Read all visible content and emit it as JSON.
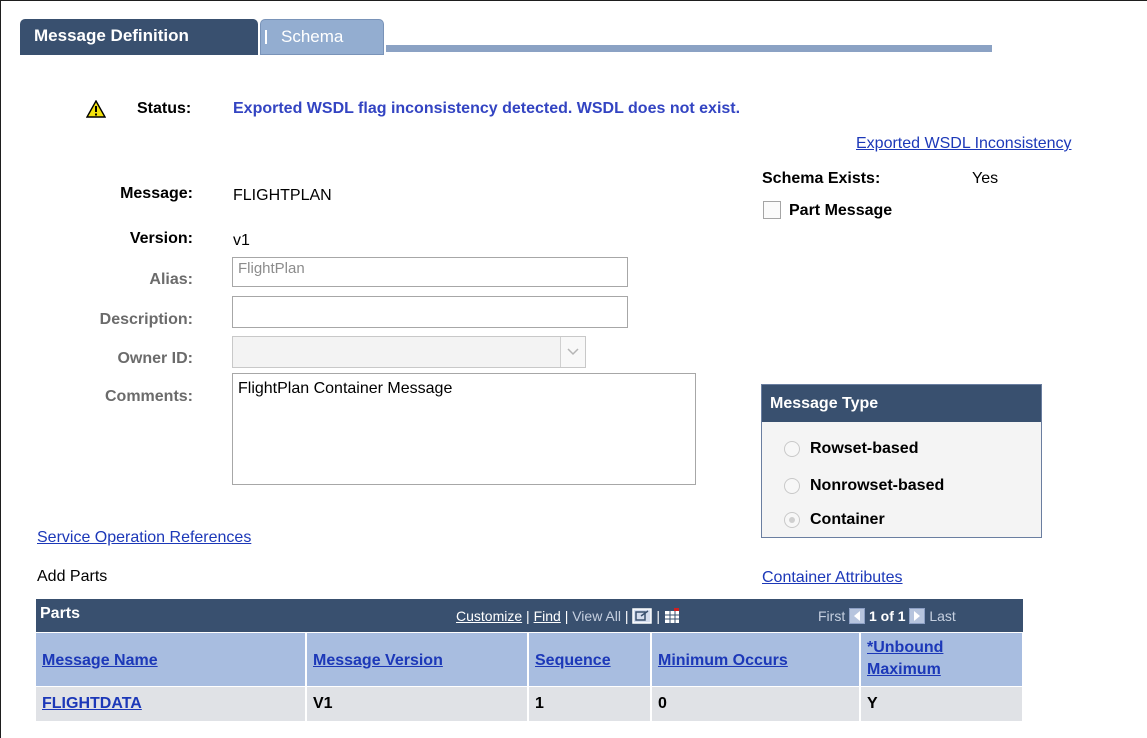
{
  "tabs": [
    {
      "label": "Message Definition",
      "active": true
    },
    {
      "label": "Schema",
      "active": false
    }
  ],
  "status": {
    "label": "Status:",
    "text": "Exported WSDL flag inconsistency detected.  WSDL does not exist.",
    "link": "Exported WSDL Inconsistency"
  },
  "schema": {
    "label": "Schema Exists:",
    "value": "Yes",
    "part_message_label": "Part Message",
    "part_message_checked": false
  },
  "fields": {
    "message_label": "Message:",
    "message_value": "FLIGHTPLAN",
    "version_label": "Version:",
    "version_value": "v1",
    "alias_label": "Alias:",
    "alias_value": "FlightPlan",
    "description_label": "Description:",
    "description_value": "",
    "owner_label": "Owner ID:",
    "owner_value": "",
    "comments_label": "Comments:",
    "comments_value": "FlightPlan Container Message"
  },
  "message_type": {
    "title": "Message Type",
    "options": [
      {
        "label": "Rowset-based",
        "selected": false
      },
      {
        "label": "Nonrowset-based",
        "selected": false
      },
      {
        "label": "Container",
        "selected": true
      }
    ]
  },
  "links": {
    "service_operation_references": "Service Operation References",
    "container_attributes": "Container Attributes"
  },
  "add_parts_label": "Add Parts",
  "parts_grid": {
    "title": "Parts",
    "customize": "Customize",
    "find": "Find",
    "view_all": "View All",
    "first": "First",
    "page_info": "1 of 1",
    "last": "Last",
    "columns": [
      "Message Name",
      "Message Version",
      "Sequence",
      "Minimum Occurs",
      "*Unbound",
      "Maximum"
    ],
    "rows": [
      {
        "message_name": "FLIGHTDATA",
        "message_version": "V1",
        "sequence": "1",
        "minimum_occurs": "0",
        "unbound_maximum": "Y"
      }
    ]
  },
  "colors": {
    "tab_active": "#39506f",
    "tab_inactive": "#93add0",
    "link": "#1c38b8",
    "status_text": "#3344c2",
    "grid_header": "#a8bde0"
  },
  "icons": [
    "warning-icon",
    "zoom-icon",
    "download-grid-icon",
    "prev-page-icon",
    "next-page-icon",
    "chevron-down-icon"
  ]
}
